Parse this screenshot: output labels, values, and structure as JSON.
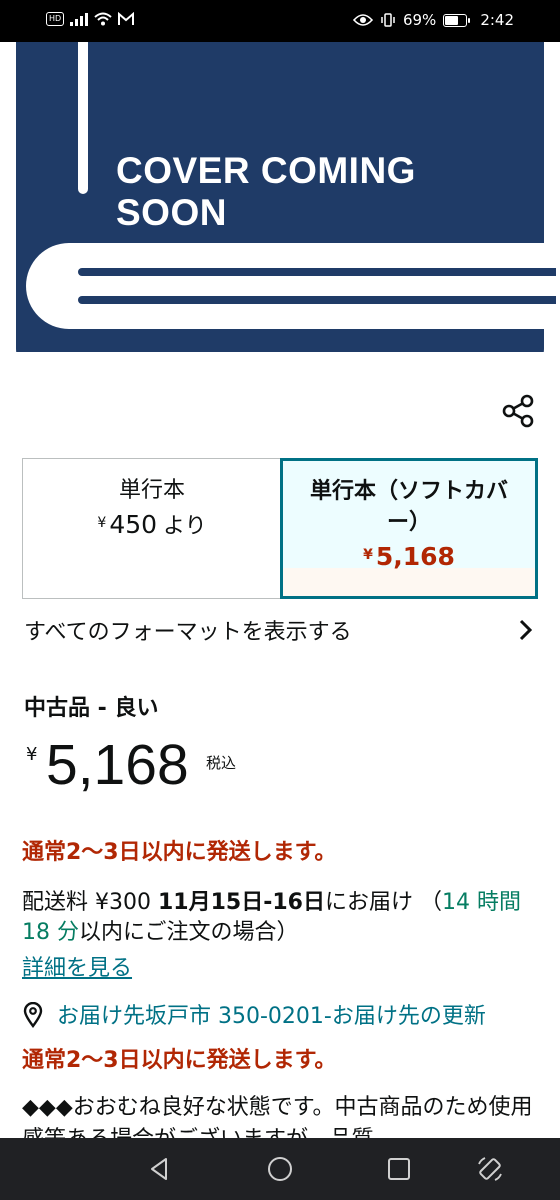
{
  "status_bar": {
    "hd_label": "HD",
    "battery_percent": "69%",
    "battery_level": 0.69,
    "time": "2:42"
  },
  "cover": {
    "text": "COVER COMING SOON",
    "colors": {
      "book": "#1f3b67",
      "pages": "#ffffff"
    }
  },
  "formats": [
    {
      "name": "単行本",
      "currency": "¥",
      "price": "450",
      "suffix": "より",
      "selected": false
    },
    {
      "name": "単行本（ソフトカバー）",
      "currency": "¥",
      "price": "5,168",
      "selected": true
    }
  ],
  "see_all_formats_label": "すべてのフォーマットを表示する",
  "condition": "中古品 - 良い",
  "price": {
    "currency": "¥",
    "amount": "5,168",
    "tax_label": "税込"
  },
  "shipping_note": "通常2〜3日以内に発送します。",
  "delivery": {
    "fee_label": "配送料 ¥300",
    "dates": "11月15日-16日",
    "arrive_label": "にお届け",
    "open_paren": "（",
    "countdown": "14 時間 18 分",
    "countdown_suffix": "以内にご注文の場合）"
  },
  "details_link": "詳細を見る",
  "location_text": "お届け先坂戸市 350-0201‐お届け先の更新",
  "description": "◆◆◆おおむね良好な状態です。中古商品のため使用感等ある場合がございますが、品質",
  "colors": {
    "accent_teal": "#007185",
    "price_red": "#b12704",
    "countdown_green": "#067d62"
  }
}
